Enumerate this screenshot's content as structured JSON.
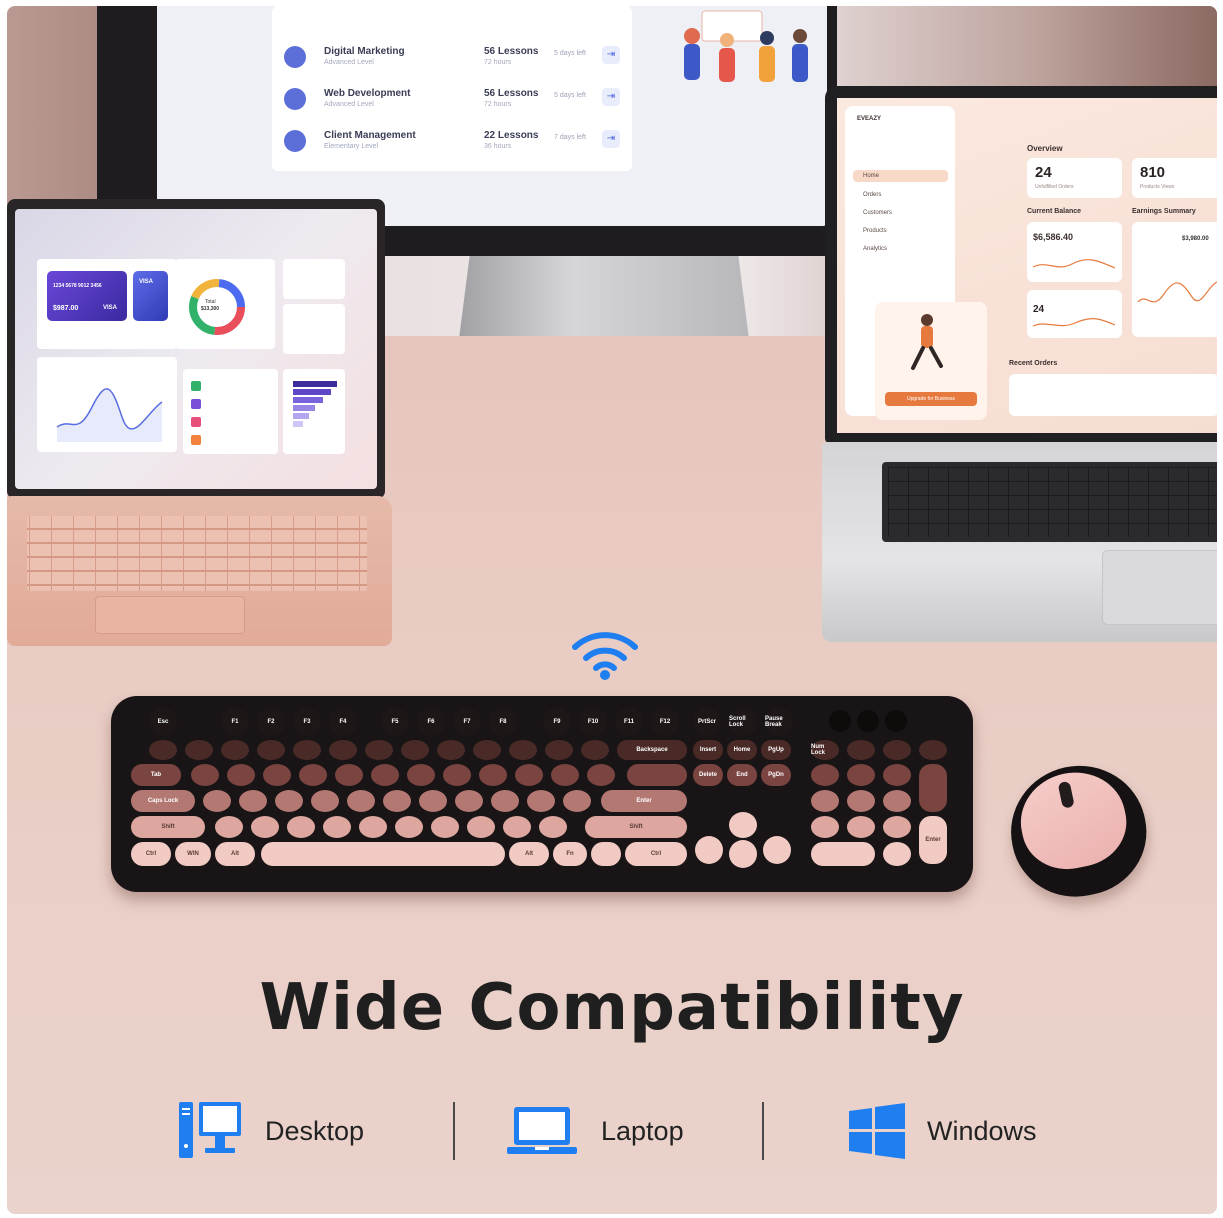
{
  "headline": "Wide Compatibility",
  "compatibility": [
    {
      "label": "Desktop",
      "icon": "desktop-icon"
    },
    {
      "label": "Laptop",
      "icon": "laptop-icon"
    },
    {
      "label": "Windows",
      "icon": "windows-icon"
    }
  ],
  "colors": {
    "accent_blue": "#1f7ef0",
    "headline": "#1f1f1f",
    "desk": "#e6c6bd"
  },
  "monitor_screen": {
    "courses": [
      {
        "title": "Digital Marketing",
        "level": "Advanced Level",
        "lessons": "56 Lessons",
        "hours": "72 hours",
        "days_left": "5 days left"
      },
      {
        "title": "Web Development",
        "level": "Advanced Level",
        "lessons": "56 Lessons",
        "hours": "72 hours",
        "days_left": "5 days left"
      },
      {
        "title": "Client Management",
        "level": "Elementary Level",
        "lessons": "22 Lessons",
        "hours": "36 hours",
        "days_left": "7 days left"
      }
    ]
  },
  "tablet_screen": {
    "card_number": "1234 5678 9012 3456",
    "card_brand": "VISA",
    "card_amount": "$987.00",
    "donut_label": "Total",
    "donut_value": "$13,300"
  },
  "laptop_screen": {
    "brand": "EVEAZY",
    "overview_label": "Overview",
    "stat_1_value": "24",
    "stat_1_label": "Unfulfilled Orders",
    "stat_2_value": "810",
    "stat_2_label": "Products Views",
    "balance_label": "Current Balance",
    "balance_value": "$6,586.40",
    "earnings_label": "Earnings Summary",
    "top_order_value": "$3,980.00",
    "orders_this_month": "24",
    "recent_orders": "Recent Orders",
    "nav": [
      "Home",
      "Orders",
      "Customers",
      "Products",
      "Analytics"
    ],
    "promo_button": "Upgrade for Business"
  },
  "keyboard": {
    "function_row": [
      "Esc",
      "F1",
      "F2",
      "F3",
      "F4",
      "F5",
      "F6",
      "F7",
      "F8",
      "F9",
      "F10",
      "F11",
      "F12",
      "PrtScr",
      "Scroll Lock",
      "Pause Break"
    ],
    "labels": {
      "backspace": "Backspace",
      "tab": "Tab",
      "caps": "Caps Lock",
      "enter": "Enter",
      "shift_l": "Shift",
      "shift_r": "Shift",
      "ctrl_l": "Ctrl",
      "win": "WIN",
      "alt_l": "Alt",
      "alt_r": "Alt",
      "fn": "Fn",
      "ctrl_r": "Ctrl",
      "insert": "Insert",
      "home": "Home",
      "pgup": "PgUp",
      "delete": "Delete",
      "end": "End",
      "pgdn": "PgDn",
      "numlock": "Num Lock",
      "numpad_enter": "Enter"
    }
  }
}
